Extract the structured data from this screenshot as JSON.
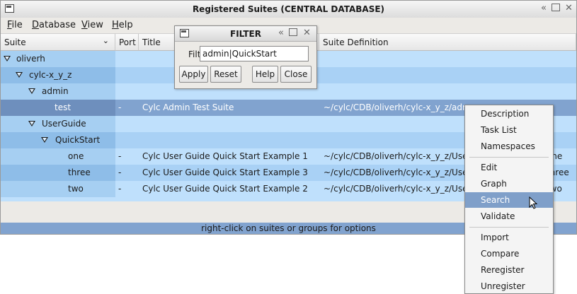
{
  "window": {
    "title": "Registered Suites (CENTRAL DATABASE)"
  },
  "menubar": {
    "items": [
      "File",
      "Database",
      "View",
      "Help"
    ],
    "mnemonics": [
      "F",
      "D",
      "V",
      "H"
    ]
  },
  "columns": [
    "Suite",
    "Port",
    "Title",
    "Suite Definition"
  ],
  "rows": [
    {
      "name": "oliverh",
      "port": "",
      "title": "",
      "path": "",
      "expanded": true
    },
    {
      "name": "cylc-x_y_z",
      "port": "",
      "title": "",
      "path": "",
      "expanded": true
    },
    {
      "name": "admin",
      "port": "",
      "title": "",
      "path": "",
      "expanded": true
    },
    {
      "name": "test",
      "port": "-",
      "title": "Cylc Admin Test Suite",
      "path": "~/cylc/CDB/oliverh/cylc-x_y_z/admin/test",
      "selected": true
    },
    {
      "name": "UserGuide",
      "port": "",
      "title": "",
      "path": "",
      "expanded": true
    },
    {
      "name": "QuickStart",
      "port": "",
      "title": "",
      "path": "",
      "expanded": true
    },
    {
      "name": "one",
      "port": "-",
      "title": "Cylc User Guide Quick Start Example 1",
      "path": "~/cylc/CDB/oliverh/cylc-x_y_z/UserGuide/QuickStart/one"
    },
    {
      "name": "three",
      "port": "-",
      "title": "Cylc User Guide Quick Start Example 3",
      "path": "~/cylc/CDB/oliverh/cylc-x_y_z/UserGuide/QuickStart/three"
    },
    {
      "name": "two",
      "port": "-",
      "title": "Cylc User Guide Quick Start Example 2",
      "path": "~/cylc/CDB/oliverh/cylc-x_y_z/UserGuide/QuickStart/two"
    }
  ],
  "status": "right-click on suites or groups for options",
  "filter_dialog": {
    "title": "FILTER",
    "label": "Filter",
    "value": "admin|QuickStart",
    "buttons": [
      "Apply",
      "Reset",
      "Help",
      "Close"
    ]
  },
  "context_menu": {
    "items": [
      "Description",
      "Task List",
      "Namespaces",
      "Edit",
      "Graph",
      "Search",
      "Validate",
      "Import",
      "Compare",
      "Reregister",
      "Unregister"
    ],
    "highlighted": "Search"
  },
  "colors": {
    "row_light": "#bfe0fc",
    "row_dark": "#a9d1f5",
    "selected": "#81a3cf",
    "menu_highlight": "#7f9fc9"
  },
  "icons": [
    "window-menu-icon",
    "shade-icon",
    "maximize-icon",
    "close-icon",
    "expander-icon",
    "chevron-down-icon",
    "pointer-cursor-icon"
  ]
}
